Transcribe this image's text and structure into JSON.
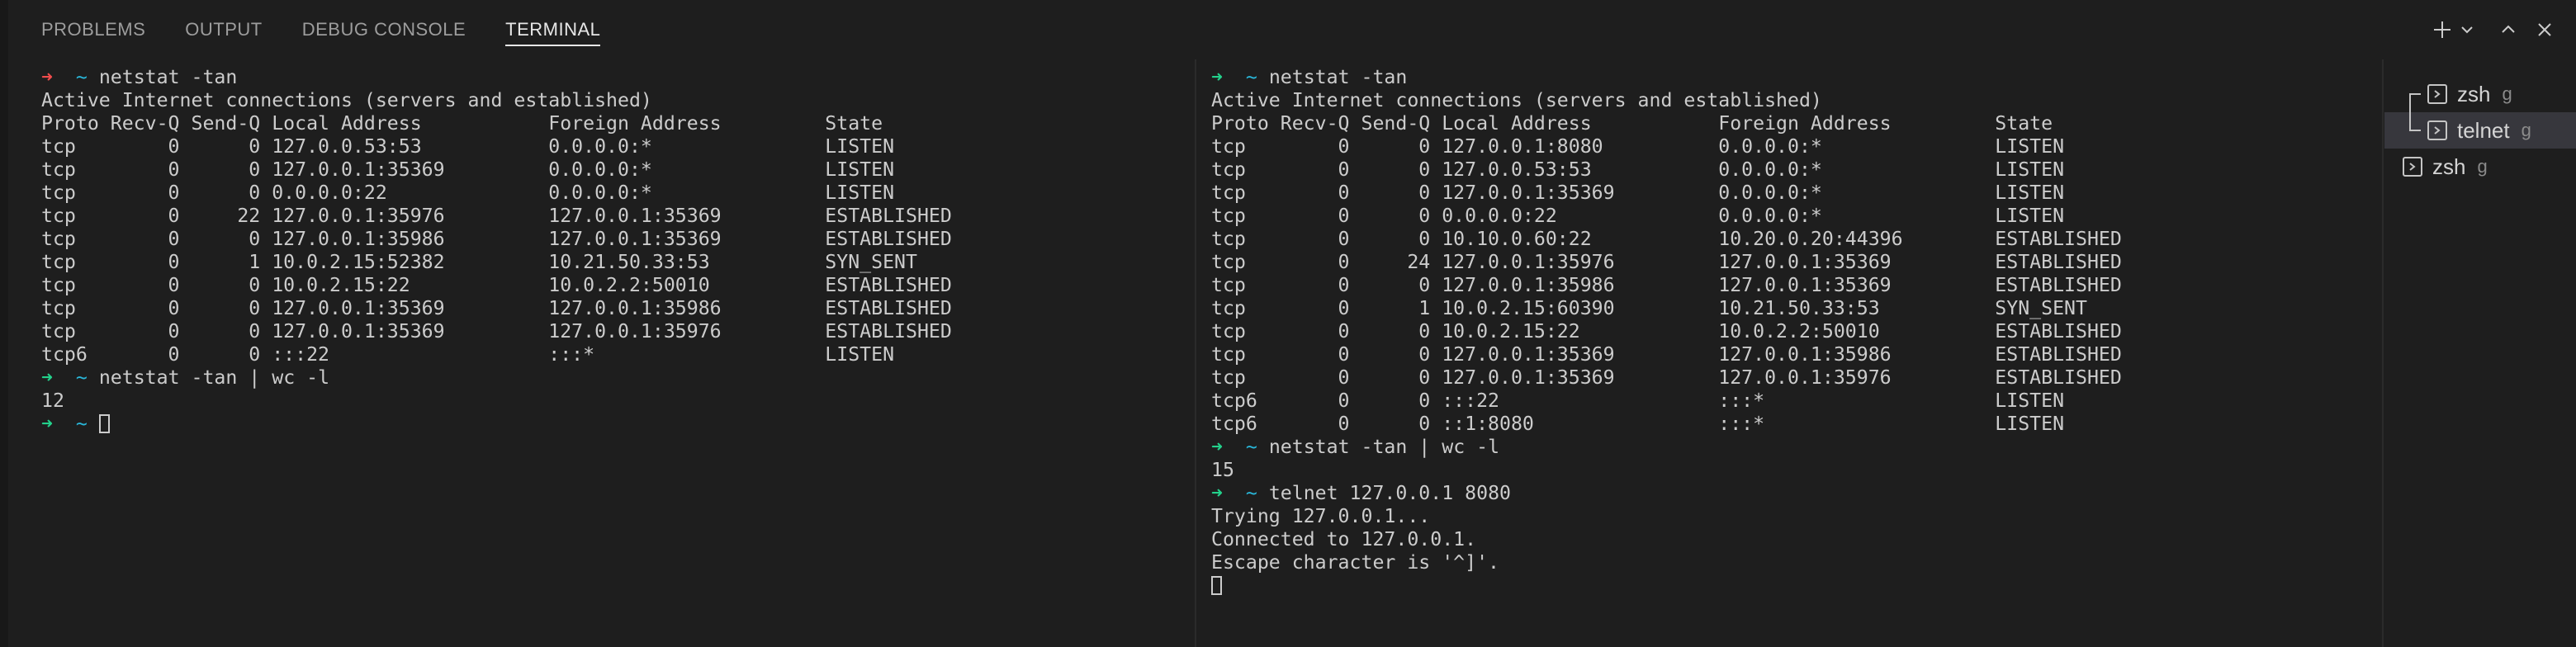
{
  "panel": {
    "tabs": [
      "PROBLEMS",
      "OUTPUT",
      "DEBUG CONSOLE",
      "TERMINAL"
    ],
    "active_tab": "TERMINAL",
    "actions": [
      "add-icon",
      "chevron-down-icon",
      "maximize-icon",
      "close-icon"
    ]
  },
  "left_pane": {
    "prompt_arrow": "➜",
    "prompt_dir": "~",
    "lines": [
      {
        "kind": "cmd",
        "arrow": "red",
        "text": "netstat -tan"
      },
      {
        "kind": "out",
        "text": "Active Internet connections (servers and established)"
      },
      {
        "kind": "out",
        "text": "Proto Recv-Q Send-Q Local Address           Foreign Address         State"
      },
      {
        "kind": "out",
        "text": "tcp        0      0 127.0.0.53:53           0.0.0.0:*               LISTEN"
      },
      {
        "kind": "out",
        "text": "tcp        0      0 127.0.0.1:35369         0.0.0.0:*               LISTEN"
      },
      {
        "kind": "out",
        "text": "tcp        0      0 0.0.0.0:22              0.0.0.0:*               LISTEN"
      },
      {
        "kind": "out",
        "text": "tcp        0     22 127.0.0.1:35976         127.0.0.1:35369         ESTABLISHED"
      },
      {
        "kind": "out",
        "text": "tcp        0      0 127.0.0.1:35986         127.0.0.1:35369         ESTABLISHED"
      },
      {
        "kind": "out",
        "text": "tcp        0      1 10.0.2.15:52382         10.21.50.33:53          SYN_SENT"
      },
      {
        "kind": "out",
        "text": "tcp        0      0 10.0.2.15:22            10.0.2.2:50010          ESTABLISHED"
      },
      {
        "kind": "out",
        "text": "tcp        0      0 127.0.0.1:35369         127.0.0.1:35986         ESTABLISHED"
      },
      {
        "kind": "out",
        "text": "tcp        0      0 127.0.0.1:35369         127.0.0.1:35976         ESTABLISHED"
      },
      {
        "kind": "out",
        "text": "tcp6       0      0 :::22                   :::*                    LISTEN"
      },
      {
        "kind": "cmd",
        "arrow": "green",
        "text": "netstat -tan | wc -l"
      },
      {
        "kind": "out",
        "text": "12"
      },
      {
        "kind": "prompt",
        "arrow": "green",
        "text": ""
      }
    ]
  },
  "right_pane": {
    "prompt_arrow": "➜",
    "prompt_dir": "~",
    "lines": [
      {
        "kind": "cmd",
        "arrow": "green",
        "text": "netstat -tan"
      },
      {
        "kind": "out",
        "text": "Active Internet connections (servers and established)"
      },
      {
        "kind": "out",
        "text": "Proto Recv-Q Send-Q Local Address           Foreign Address         State"
      },
      {
        "kind": "out",
        "text": "tcp        0      0 127.0.0.1:8080          0.0.0.0:*               LISTEN"
      },
      {
        "kind": "out",
        "text": "tcp        0      0 127.0.0.53:53           0.0.0.0:*               LISTEN"
      },
      {
        "kind": "out",
        "text": "tcp        0      0 127.0.0.1:35369         0.0.0.0:*               LISTEN"
      },
      {
        "kind": "out",
        "text": "tcp        0      0 0.0.0.0:22              0.0.0.0:*               LISTEN"
      },
      {
        "kind": "out",
        "text": "tcp        0      0 10.10.0.60:22           10.20.0.20:44396        ESTABLISHED"
      },
      {
        "kind": "out",
        "text": "tcp        0     24 127.0.0.1:35976         127.0.0.1:35369         ESTABLISHED"
      },
      {
        "kind": "out",
        "text": "tcp        0      0 127.0.0.1:35986         127.0.0.1:35369         ESTABLISHED"
      },
      {
        "kind": "out",
        "text": "tcp        0      1 10.0.2.15:60390         10.21.50.33:53          SYN_SENT"
      },
      {
        "kind": "out",
        "text": "tcp        0      0 10.0.2.15:22            10.0.2.2:50010          ESTABLISHED"
      },
      {
        "kind": "out",
        "text": "tcp        0      0 127.0.0.1:35369         127.0.0.1:35986         ESTABLISHED"
      },
      {
        "kind": "out",
        "text": "tcp        0      0 127.0.0.1:35369         127.0.0.1:35976         ESTABLISHED"
      },
      {
        "kind": "out",
        "text": "tcp6       0      0 :::22                   :::*                    LISTEN"
      },
      {
        "kind": "out",
        "text": "tcp6       0      0 ::1:8080                :::*                    LISTEN"
      },
      {
        "kind": "cmd",
        "arrow": "green",
        "text": "netstat -tan | wc -l"
      },
      {
        "kind": "out",
        "text": "15"
      },
      {
        "kind": "cmd",
        "arrow": "green",
        "text": "telnet 127.0.0.1 8080"
      },
      {
        "kind": "out",
        "text": "Trying 127.0.0.1..."
      },
      {
        "kind": "out",
        "text": "Connected to 127.0.0.1."
      },
      {
        "kind": "out",
        "text": "Escape character is '^]'."
      },
      {
        "kind": "cursor",
        "text": ""
      }
    ]
  },
  "terminal_list": [
    {
      "name": "zsh",
      "sub": "g",
      "tree": "top",
      "selected": false
    },
    {
      "name": "telnet",
      "sub": "g",
      "tree": "bottom",
      "selected": true
    },
    {
      "name": "zsh",
      "sub": "g",
      "tree": "none",
      "selected": false
    }
  ],
  "colors": {
    "background": "#1e1e1e",
    "arrow_red": "#f14c4c",
    "arrow_green": "#23d18b",
    "tilde": "#29b8db",
    "text": "#cccccc",
    "selected_row": "#37373d"
  }
}
